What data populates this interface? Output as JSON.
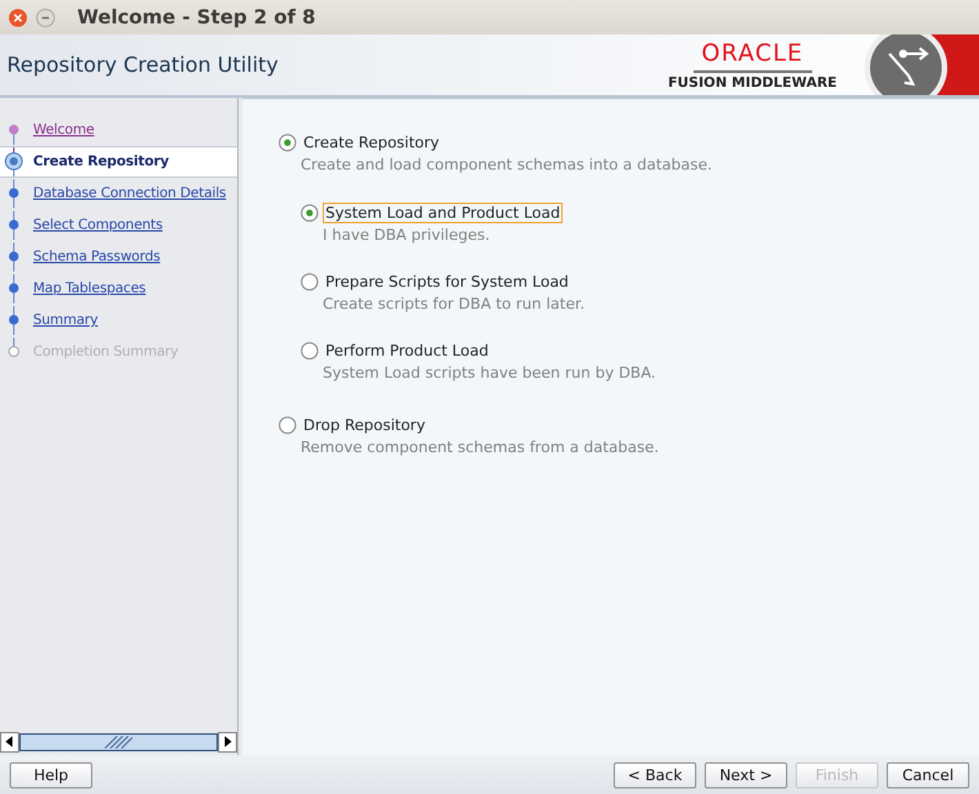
{
  "window": {
    "title": "Welcome - Step 2 of 8"
  },
  "header": {
    "title": "Repository Creation Utility",
    "brand": "ORACLE",
    "product": "FUSION MIDDLEWARE"
  },
  "steps": [
    {
      "label": "Welcome",
      "kind": "visited"
    },
    {
      "label": "Create Repository",
      "kind": "current"
    },
    {
      "label": "Database Connection Details",
      "kind": "link"
    },
    {
      "label": "Select Components",
      "kind": "link"
    },
    {
      "label": "Schema Passwords",
      "kind": "link"
    },
    {
      "label": "Map Tablespaces",
      "kind": "link"
    },
    {
      "label": "Summary",
      "kind": "link"
    },
    {
      "label": "Completion Summary",
      "kind": "pending"
    }
  ],
  "options": [
    {
      "label": "Create Repository",
      "description": "Create and load component schemas into a database.",
      "selected": true,
      "children": [
        {
          "label": "System Load and Product Load",
          "description": "I have DBA privileges.",
          "selected": true,
          "focused": true
        },
        {
          "label": "Prepare Scripts for System Load",
          "description": "Create scripts for DBA to run later.",
          "selected": false,
          "focused": false
        },
        {
          "label": "Perform Product Load",
          "description": "System Load scripts have been run by DBA.",
          "selected": false,
          "focused": false
        }
      ]
    },
    {
      "label": "Drop Repository",
      "description": "Remove component schemas from a database.",
      "selected": false
    }
  ],
  "buttons": [
    {
      "label": "Help",
      "kind": "left",
      "disabled": false
    },
    {
      "label": "< Back",
      "kind": "right",
      "disabled": false
    },
    {
      "label": "Next >",
      "kind": "right",
      "disabled": false
    },
    {
      "label": "Finish",
      "kind": "right",
      "disabled": true
    },
    {
      "label": "Cancel",
      "kind": "right",
      "disabled": false
    }
  ]
}
